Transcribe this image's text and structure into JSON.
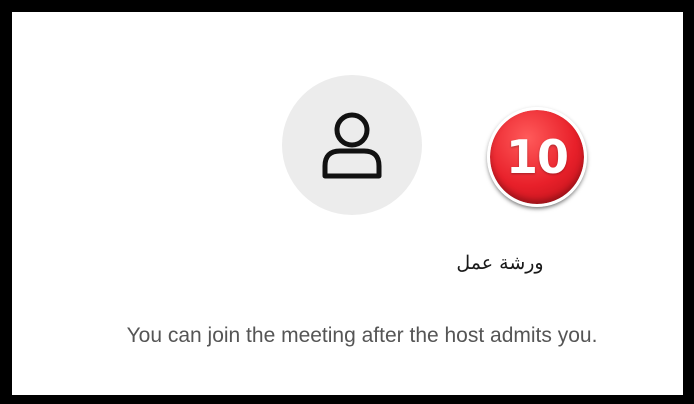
{
  "participant": {
    "display_name": "ورشة عمل",
    "avatar_icon": "user-icon"
  },
  "annotation": {
    "badge_number": "10",
    "badge_color": "#e8202a"
  },
  "lobby": {
    "message": "You can join the meeting after the host admits you."
  },
  "colors": {
    "avatar_bg": "#ececec",
    "message_text": "#555555"
  }
}
